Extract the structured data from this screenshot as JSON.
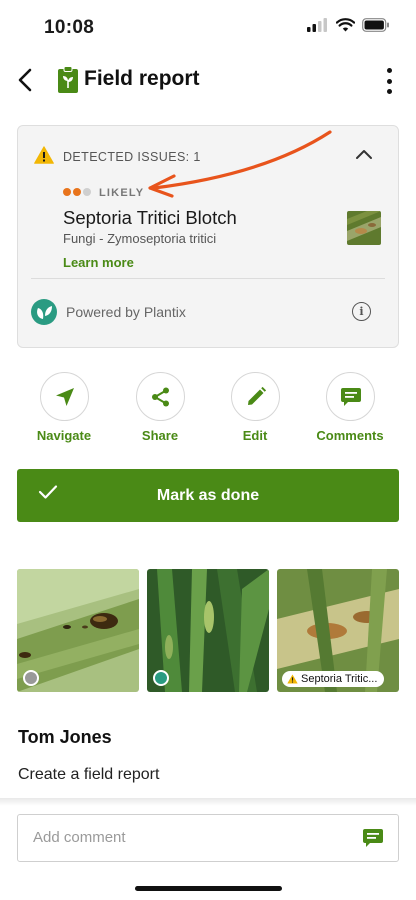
{
  "status_bar": {
    "time": "10:08"
  },
  "header": {
    "title": "Field report"
  },
  "issue_card": {
    "heading": "DETECTED ISSUES: 1",
    "likelihood": "LIKELY",
    "likelihood_level": 2,
    "likelihood_max": 3,
    "disease_name": "Septoria Tritici Blotch",
    "disease_subtitle": "Fungi - Zymoseptoria tritici",
    "learn_more": "Learn more",
    "powered_by": "Powered by Plantix",
    "info_glyph": "i"
  },
  "actions": [
    {
      "label": "Navigate",
      "icon": "navigate-arrow-icon"
    },
    {
      "label": "Share",
      "icon": "share-icon"
    },
    {
      "label": "Edit",
      "icon": "pencil-icon"
    },
    {
      "label": "Comments",
      "icon": "comment-icon"
    }
  ],
  "mark_done": {
    "label": "Mark as done"
  },
  "photos": [
    {
      "status": "grey-radio"
    },
    {
      "status": "green-radio"
    },
    {
      "status": "issue-chip",
      "chip_label": "Septoria Tritic..."
    }
  ],
  "report": {
    "author": "Tom Jones",
    "activity": "Create a field report"
  },
  "comment": {
    "placeholder": "Add comment"
  },
  "colors": {
    "brand_green": "#4a8a16",
    "warning": "#f2b705",
    "likely_orange": "#e8741c",
    "annotation_arrow": "#e8541c",
    "plantix_teal": "#2a9b82"
  }
}
